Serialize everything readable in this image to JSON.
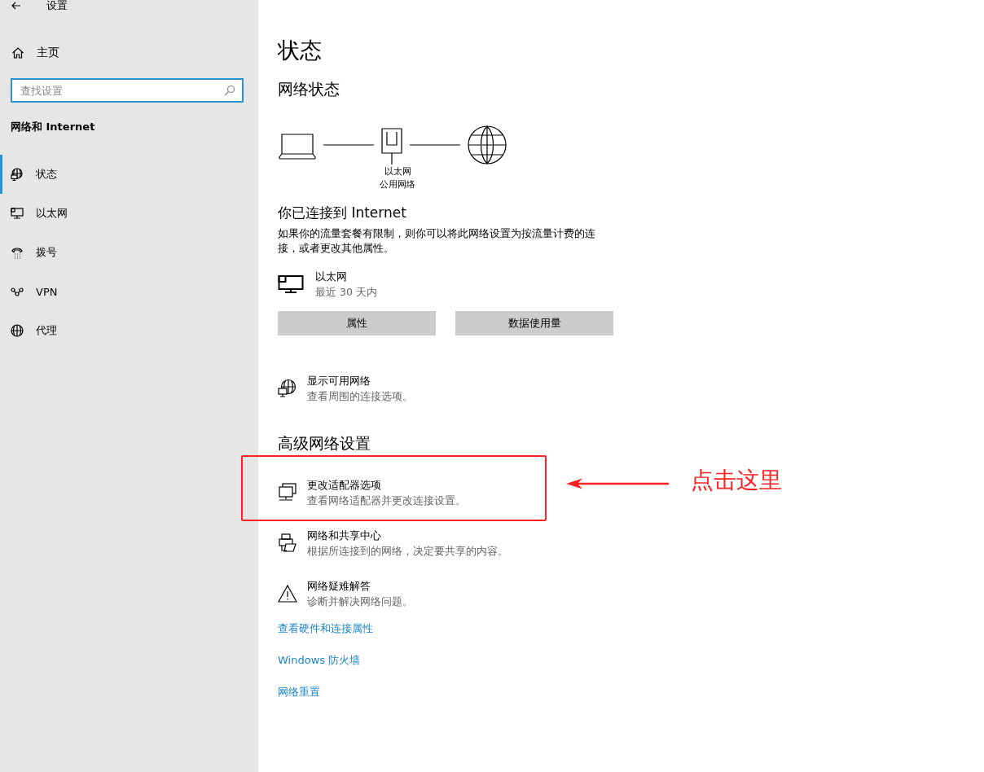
{
  "sidebar": {
    "title": "设置",
    "home": "主页",
    "search": {
      "placeholder": "查找设置"
    },
    "category": "网络和 Internet",
    "items": [
      {
        "label": "状态",
        "selected": true
      },
      {
        "label": "以太网",
        "selected": false
      },
      {
        "label": "拨号",
        "selected": false
      },
      {
        "label": "VPN",
        "selected": false
      },
      {
        "label": "代理",
        "selected": false
      }
    ]
  },
  "main": {
    "title": "状态",
    "network_heading": "网络状态",
    "diagram": {
      "labels": [
        "以太网",
        "公用网络"
      ]
    },
    "connection": {
      "title": "你已连接到 Internet",
      "description": "如果你的流量套餐有限制，则你可以将此网络设置为按流量计费的连接，或者更改其他属性。"
    },
    "adapter": {
      "name": "以太网",
      "detail": "最近 30 天内"
    },
    "buttons": [
      "属性",
      "数据使用量"
    ],
    "options": [
      {
        "title": "显示可用网络",
        "description": "查看周围的连接选项。",
        "highlighted": false
      }
    ],
    "advanced_heading": "高级网络设置",
    "advanced_options": [
      {
        "title": "更改适配器选项",
        "description": "查看网络适配器并更改连接设置。",
        "highlighted": true
      },
      {
        "title": "网络和共享中心",
        "description": "根据所连接到的网络，决定要共享的内容。",
        "highlighted": false
      },
      {
        "title": "网络疑难解答",
        "description": "诊断并解决网络问题。",
        "highlighted": false
      }
    ],
    "links": [
      "查看硬件和连接属性",
      "Windows 防火墙",
      "网络重置"
    ]
  },
  "annotation": {
    "label": "点击这里"
  }
}
